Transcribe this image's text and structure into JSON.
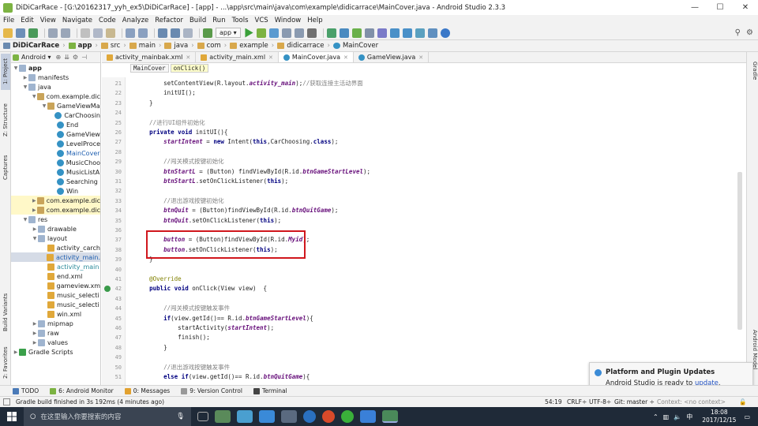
{
  "window": {
    "title": "DiDiCarRace - [G:\\20162317_yyh_ex5\\DiDiCarRace] - [app] - ...\\app\\src\\main\\java\\com\\example\\didicarrace\\MainCover.java - Android Studio 2.3.3",
    "minimize": "—",
    "maximize": "☐",
    "close": "✕"
  },
  "menu": [
    "File",
    "Edit",
    "View",
    "Navigate",
    "Code",
    "Analyze",
    "Refactor",
    "Build",
    "Run",
    "Tools",
    "VCS",
    "Window",
    "Help"
  ],
  "toolbar": {
    "run_config": "app ▾"
  },
  "nav": [
    "DiDiCarRace",
    "app",
    "src",
    "main",
    "java",
    "com",
    "example",
    "didicarrace",
    "MainCover"
  ],
  "left_tabs": {
    "project": "1: Project",
    "structure": "Z: Structure",
    "captures": "Captures",
    "build_variants": "Build Variants",
    "favorites": "2: Favorites"
  },
  "right_tabs": {
    "gradle": "Gradle",
    "android_model": "Android Model"
  },
  "project": {
    "view_mode": "Android ▾",
    "tree": [
      {
        "label": "app",
        "indent": 0,
        "arrow": "▼",
        "icon": "folder",
        "bold": true
      },
      {
        "label": "manifests",
        "indent": 1,
        "arrow": "▶",
        "icon": "folder"
      },
      {
        "label": "java",
        "indent": 1,
        "arrow": "▼",
        "icon": "folder"
      },
      {
        "label": "com.example.dic",
        "indent": 2,
        "arrow": "▼",
        "icon": "package"
      },
      {
        "label": "GameViewMa",
        "indent": 3,
        "arrow": "▼",
        "icon": "package"
      },
      {
        "label": "CarChoosin",
        "indent": 4,
        "arrow": "",
        "icon": "class"
      },
      {
        "label": "End",
        "indent": 4,
        "arrow": "",
        "icon": "class"
      },
      {
        "label": "GameView",
        "indent": 4,
        "arrow": "",
        "icon": "class"
      },
      {
        "label": "LevelProce",
        "indent": 4,
        "arrow": "",
        "icon": "class"
      },
      {
        "label": "MainCover",
        "indent": 4,
        "arrow": "",
        "icon": "class",
        "blue": true
      },
      {
        "label": "MusicChoo",
        "indent": 4,
        "arrow": "",
        "icon": "class"
      },
      {
        "label": "MusicListA",
        "indent": 4,
        "arrow": "",
        "icon": "class"
      },
      {
        "label": "Searching",
        "indent": 4,
        "arrow": "",
        "icon": "class"
      },
      {
        "label": "Win",
        "indent": 4,
        "arrow": "",
        "icon": "class"
      },
      {
        "label": "com.example.dic",
        "indent": 2,
        "arrow": "▶",
        "icon": "package",
        "hl": true
      },
      {
        "label": "com.example.dic",
        "indent": 2,
        "arrow": "▶",
        "icon": "package",
        "hl": true
      },
      {
        "label": "res",
        "indent": 1,
        "arrow": "▼",
        "icon": "folder"
      },
      {
        "label": "drawable",
        "indent": 2,
        "arrow": "▶",
        "icon": "folder"
      },
      {
        "label": "layout",
        "indent": 2,
        "arrow": "▼",
        "icon": "folder"
      },
      {
        "label": "activity_carch",
        "indent": 3,
        "arrow": "",
        "icon": "xml"
      },
      {
        "label": "activity_main.",
        "indent": 3,
        "arrow": "",
        "icon": "xml",
        "selected": true,
        "blue": true
      },
      {
        "label": "activity_main",
        "indent": 3,
        "arrow": "",
        "icon": "xml",
        "teal": true
      },
      {
        "label": "end.xml",
        "indent": 3,
        "arrow": "",
        "icon": "xml"
      },
      {
        "label": "gameview.xm",
        "indent": 3,
        "arrow": "",
        "icon": "xml"
      },
      {
        "label": "music_selecti",
        "indent": 3,
        "arrow": "",
        "icon": "xml"
      },
      {
        "label": "music_selecti",
        "indent": 3,
        "arrow": "",
        "icon": "xml"
      },
      {
        "label": "win.xml",
        "indent": 3,
        "arrow": "",
        "icon": "xml"
      },
      {
        "label": "mipmap",
        "indent": 2,
        "arrow": "▶",
        "icon": "folder"
      },
      {
        "label": "raw",
        "indent": 2,
        "arrow": "▶",
        "icon": "folder"
      },
      {
        "label": "values",
        "indent": 2,
        "arrow": "▶",
        "icon": "folder"
      },
      {
        "label": "Gradle Scripts",
        "indent": 0,
        "arrow": "▶",
        "icon": "gradle"
      }
    ]
  },
  "tabs": [
    {
      "label": "activity_mainbak.xml",
      "icon": "xml"
    },
    {
      "label": "activity_main.xml",
      "icon": "xml"
    },
    {
      "label": "MainCover.java",
      "icon": "class",
      "active": true
    },
    {
      "label": "GameView.java",
      "icon": "class"
    }
  ],
  "breadcrumbs": [
    "MainCover",
    "onClick()"
  ],
  "code": {
    "first_line_number": 21,
    "lines": [
      [
        [
          "        setContentView(R.layout.",
          ""
        ],
        [
          "activity_main",
          "fd"
        ],
        [
          ");",
          ""
        ],
        [
          "//获取连接主活动界面",
          "cm"
        ]
      ],
      [
        [
          "        initUI();",
          ""
        ]
      ],
      [
        [
          "    }",
          ""
        ]
      ],
      [
        [
          "",
          ""
        ]
      ],
      [
        [
          "    //进行UI组件初始化",
          "cm"
        ]
      ],
      [
        [
          "    ",
          ""
        ],
        [
          "private void ",
          "kw"
        ],
        [
          "initUI(){",
          ""
        ]
      ],
      [
        [
          "        ",
          ""
        ],
        [
          "startIntent",
          "fd"
        ],
        [
          " = ",
          ""
        ],
        [
          "new ",
          "kw"
        ],
        [
          "Intent(",
          ""
        ],
        [
          "this",
          "kw"
        ],
        [
          ",CarChoosing.",
          ""
        ],
        [
          "class",
          "kw"
        ],
        [
          ");",
          ""
        ]
      ],
      [
        [
          "",
          ""
        ]
      ],
      [
        [
          "        //闯关模式按键初始化",
          "cm"
        ]
      ],
      [
        [
          "        ",
          ""
        ],
        [
          "btnStartL",
          "fd"
        ],
        [
          " = (Button) findViewById(R.id.",
          ""
        ],
        [
          "btnGameStartLevel",
          "fd"
        ],
        [
          ");",
          ""
        ]
      ],
      [
        [
          "        ",
          ""
        ],
        [
          "btnStartL",
          "fd"
        ],
        [
          ".setOnClickListener(",
          ""
        ],
        [
          "this",
          "kw"
        ],
        [
          ");",
          ""
        ]
      ],
      [
        [
          "",
          ""
        ]
      ],
      [
        [
          "        //退出游戏按键初始化",
          "cm"
        ]
      ],
      [
        [
          "        ",
          ""
        ],
        [
          "btnQuit",
          "fd"
        ],
        [
          " = (Button)findViewById(R.id.",
          ""
        ],
        [
          "btnQuitGame",
          "fd"
        ],
        [
          ");",
          ""
        ]
      ],
      [
        [
          "        ",
          ""
        ],
        [
          "btnQuit",
          "fd"
        ],
        [
          ".setOnClickListener(",
          ""
        ],
        [
          "this",
          "kw"
        ],
        [
          ");",
          ""
        ]
      ],
      [
        [
          "",
          ""
        ]
      ],
      [
        [
          "        ",
          ""
        ],
        [
          "button",
          "fd"
        ],
        [
          " = (Button)findViewById(R.id.",
          ""
        ],
        [
          "Myid",
          "fd"
        ],
        [
          ");",
          ""
        ]
      ],
      [
        [
          "        ",
          ""
        ],
        [
          "button",
          "fd"
        ],
        [
          ".setOnClickListener(",
          ""
        ],
        [
          "this",
          "kw"
        ],
        [
          ");",
          ""
        ]
      ],
      [
        [
          "    }",
          ""
        ]
      ],
      [
        [
          "",
          ""
        ]
      ],
      [
        [
          "    @Override",
          "an"
        ]
      ],
      [
        [
          "    ",
          ""
        ],
        [
          "public void ",
          "kw"
        ],
        [
          "onClick(View view)  {",
          ""
        ]
      ],
      [
        [
          "",
          ""
        ]
      ],
      [
        [
          "        //闯关模式按键触发事件",
          "cm"
        ]
      ],
      [
        [
          "        ",
          ""
        ],
        [
          "if",
          "kw"
        ],
        [
          "(view.getId()== R.id.",
          ""
        ],
        [
          "btnGameStartLevel",
          "fd"
        ],
        [
          "){",
          ""
        ]
      ],
      [
        [
          "            startActivity(",
          ""
        ],
        [
          "startIntent",
          "fd"
        ],
        [
          ");",
          ""
        ]
      ],
      [
        [
          "            finish();",
          ""
        ]
      ],
      [
        [
          "        }",
          ""
        ]
      ],
      [
        [
          "",
          ""
        ]
      ],
      [
        [
          "        //退出游戏按键触发事件",
          "cm"
        ]
      ],
      [
        [
          "        ",
          ""
        ],
        [
          "else if",
          "kw"
        ],
        [
          "(view.getId()== R.id.",
          ""
        ],
        [
          "btnQuitGame",
          "fd"
        ],
        [
          "){",
          ""
        ]
      ]
    ]
  },
  "bottom_tabs": [
    {
      "label": "TODO",
      "color": "#4a7ab8"
    },
    {
      "label": "6: Android Monitor",
      "color": "#7cb342"
    },
    {
      "label": "0: Messages",
      "color": "#e2a12f"
    },
    {
      "label": "9: Version Control",
      "color": "#999999"
    },
    {
      "label": "Terminal",
      "color": "#444444"
    }
  ],
  "status": {
    "message": "Gradle build finished in 3s 192ms (4 minutes ago)",
    "position": "54:19",
    "line_sep": "CRLF÷",
    "encoding": "UTF-8÷",
    "git": "Git: master ÷",
    "context": "Context: <no context>"
  },
  "notification": {
    "title": "Platform and Plugin Updates",
    "body_prefix": "Android Studio is ready to ",
    "link": "update",
    "body_suffix": "."
  },
  "taskbar": {
    "search_placeholder": "在这里输入你要搜索的内容",
    "time": "18:08",
    "date": "2017/12/15",
    "ime": "中"
  },
  "colors": {
    "accent": "#3592c4",
    "highlight_box": "#d0171d"
  }
}
